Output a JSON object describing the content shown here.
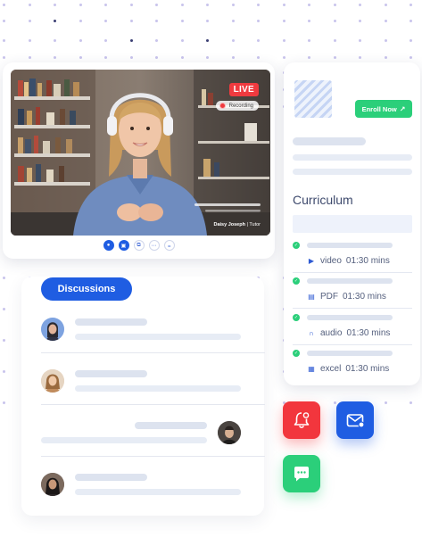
{
  "video": {
    "live_label": "LIVE",
    "recording_label": "Recording",
    "presenter_name": "Daisy Joseph",
    "presenter_role": "Tutor",
    "controls": [
      {
        "icon": "microphone-icon",
        "glyph": "●",
        "active": true
      },
      {
        "icon": "camera-icon",
        "glyph": "▣",
        "active": true
      },
      {
        "icon": "screen-share-icon",
        "glyph": "⧉",
        "active": false
      },
      {
        "icon": "chat-icon",
        "glyph": "⋯",
        "active": false
      },
      {
        "icon": "more-icon",
        "glyph": "•••",
        "active": false
      }
    ]
  },
  "discussions": {
    "button_label": "Discussions"
  },
  "curriculum": {
    "enroll_label": "Enroll Now",
    "enroll_icon": "arrow-up-right-icon",
    "title": "Curriculum",
    "lessons": [
      {
        "type": "video",
        "duration": "01:30 mins",
        "icon": "play-circle-icon"
      },
      {
        "type": "PDF",
        "duration": "01:30 mins",
        "icon": "document-icon"
      },
      {
        "type": "audio",
        "duration": "01:30 mins",
        "icon": "headphones-icon"
      },
      {
        "type": "excel",
        "duration": "01:30 mins",
        "icon": "spreadsheet-icon"
      }
    ]
  },
  "actions": [
    {
      "name": "notification-bell",
      "color": "#f2363d"
    },
    {
      "name": "mail",
      "color": "#1f5de2"
    },
    {
      "name": "chat",
      "color": "#2bcf7a"
    }
  ],
  "colors": {
    "primary": "#1f5de2",
    "success": "#2bcf7a",
    "danger": "#f2363d",
    "placeholder": "#dde3ef"
  }
}
